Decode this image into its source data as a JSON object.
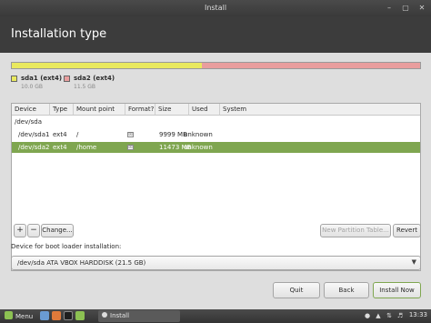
{
  "window": {
    "title": "Install",
    "controls": {
      "minimize": "–",
      "maximize": "▢",
      "close": "✕"
    }
  },
  "header": {
    "title": "Installation type"
  },
  "partition_bar": {
    "segments": [
      {
        "name": "sda1 (ext4)",
        "size": "10.0 GB",
        "color": "#e9e95e",
        "fraction": 0.465
      },
      {
        "name": "sda2 (ext4)",
        "size": "11.5 GB",
        "color": "#e99e9e",
        "fraction": 0.535
      }
    ]
  },
  "table": {
    "columns": [
      "Device",
      "Type",
      "Mount point",
      "Format?",
      "Size",
      "Used",
      "System"
    ],
    "rows": [
      {
        "device": "/dev/sda",
        "type": "",
        "mount": "",
        "format": "",
        "size": "",
        "used": "",
        "system": "",
        "selected": false
      },
      {
        "device": "/dev/sda1",
        "type": "ext4",
        "mount": "/",
        "format": "☒",
        "size": "9999 MB",
        "used": "unknown",
        "system": "",
        "selected": false
      },
      {
        "device": "/dev/sda2",
        "type": "ext4",
        "mount": "/home",
        "format": "☒",
        "size": "11473 MB",
        "used": "unknown",
        "system": "",
        "selected": true
      }
    ]
  },
  "table_buttons": {
    "add": "+",
    "remove": "−",
    "change": "Change...",
    "new_partition_table": "New Partition Table...",
    "revert": "Revert"
  },
  "boot_loader": {
    "label": "Device for boot loader installation:",
    "selected": "/dev/sda   ATA VBOX HARDDISK (21.5 GB)"
  },
  "actions": {
    "quit": "Quit",
    "back": "Back",
    "install_now": "Install Now"
  },
  "taskbar": {
    "menu_label": "Menu",
    "task_label": "Install",
    "clock": "13:33"
  },
  "colors": {
    "accent": "#7fa650",
    "header_bg": "#3c3c3c"
  }
}
